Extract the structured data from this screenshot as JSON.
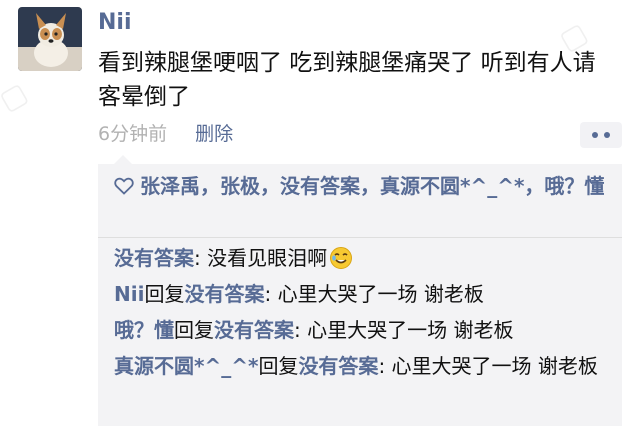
{
  "post": {
    "author": "Nii",
    "text": "看到辣腿堡哽咽了 吃到辣腿堡痛哭了 听到有人请客晕倒了",
    "time": "6分钟前",
    "delete_label": "删除",
    "more_icon": "more-dots-icon"
  },
  "likes": {
    "icon": "heart-icon",
    "names": "张泽禹，张极，没有答案，真源不圆*^_^*，哦？懂"
  },
  "comments": [
    {
      "author": "没有答案",
      "reply_label": "",
      "reply_to": "",
      "sep": ": ",
      "text": "没看见眼泪啊",
      "emoji": "tearful-laugh-emoji-icon"
    },
    {
      "author": "Nii",
      "reply_label": "回复",
      "reply_to": "没有答案",
      "sep": ": ",
      "text": "心里大哭了一场 谢老板"
    },
    {
      "author": "哦？懂",
      "reply_label": "回复",
      "reply_to": "没有答案",
      "sep": ": ",
      "text": "心里大哭了一场 谢老板"
    },
    {
      "author": "真源不圆*^_^*",
      "reply_label": "回复",
      "reply_to": "没有答案",
      "sep": ": ",
      "text": "心里大哭了一场 谢老板"
    }
  ],
  "colors": {
    "link": "#576b95",
    "text": "#111111",
    "muted": "#b2b2b2",
    "panel": "#f3f3f5"
  }
}
